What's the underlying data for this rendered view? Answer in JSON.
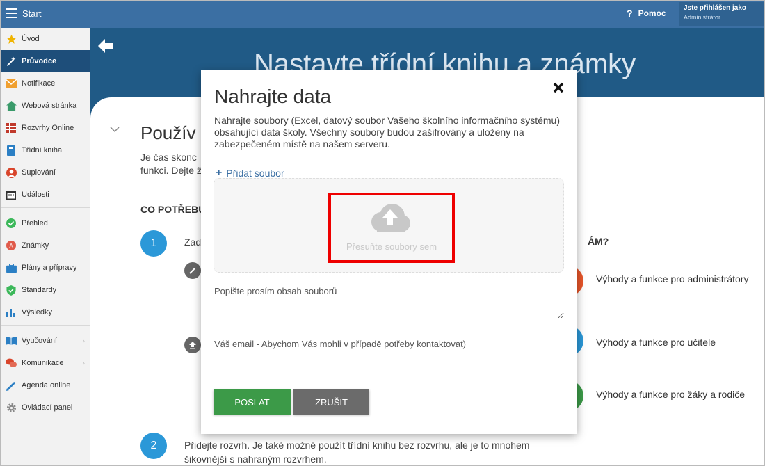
{
  "topbar": {
    "app_title": "Start",
    "help_label": "Pomoc",
    "user_line1": "Jste přihlášen jako",
    "user_line2": "Administrátor"
  },
  "sidebar": {
    "items": [
      {
        "label": "Úvod",
        "icon": "star-icon"
      },
      {
        "label": "Průvodce",
        "icon": "magic-wand-icon"
      },
      {
        "label": "Notifikace",
        "icon": "envelope-icon"
      },
      {
        "label": "Webová stránka",
        "icon": "home-icon"
      },
      {
        "label": "Rozvrhy Online",
        "icon": "calendar-grid-icon"
      },
      {
        "label": "Třídní kniha",
        "icon": "book-icon"
      },
      {
        "label": "Suplování",
        "icon": "person-icon"
      },
      {
        "label": "Události",
        "icon": "calendar-icon"
      },
      {
        "label": "Přehled",
        "icon": "check-circle-icon"
      },
      {
        "label": "Známky",
        "icon": "grade-icon"
      },
      {
        "label": "Plány a přípravy",
        "icon": "briefcase-icon"
      },
      {
        "label": "Standardy",
        "icon": "shield-check-icon"
      },
      {
        "label": "Výsledky",
        "icon": "bar-chart-icon"
      },
      {
        "label": "Vyučování",
        "icon": "open-book-icon"
      },
      {
        "label": "Komunikace",
        "icon": "chat-icon"
      },
      {
        "label": "Agenda online",
        "icon": "pen-icon"
      },
      {
        "label": "Ovládací panel",
        "icon": "gear-icon"
      }
    ]
  },
  "main": {
    "hero_title": "Nastavte třídní knihu a známky",
    "section_title": "Použív",
    "para": "Je čas skonc funkci. Dejte žáků.",
    "need_heading": "CO POTŘEBU",
    "step1_num": "1",
    "step1_text": "Zad",
    "step2_num": "2",
    "step2_text": "Přidejte rozvrh. Je také možné použít třídní knihu bez rozvrhu, ale je to mnohem šikovnější s nahraným rozvrhem.",
    "right_question": "ÁM?",
    "features": [
      {
        "text": "Výhody a funkce pro administrátory",
        "color": "#e8562a"
      },
      {
        "text": "Výhody a funkce pro učitele",
        "color": "#2b98d8"
      },
      {
        "text": "Výhody a funkce pro žáky a rodiče",
        "color": "#3c9a48"
      }
    ]
  },
  "modal": {
    "title": "Nahrajte data",
    "description": "Nahrajte soubory (Excel, datový soubor Vašeho školního informačního systému) obsahující data školy. Všechny soubory budou zašifrovány a uloženy na zabezpečeném místě na našem serveru.",
    "add_file": "Přidat soubor",
    "drop_text": "Přesuňte soubory sem",
    "describe_label": "Popište prosím obsah souborů",
    "email_label": "Váš email - Abychom Vás mohli v případě potřeby kontaktovat)",
    "email_value": "",
    "send_label": "POSLAT",
    "cancel_label": "ZRUŠIT"
  },
  "colors": {
    "topbar": "#3b6fa3",
    "hero": "#205a86",
    "active_sidebar": "#1e4e7a",
    "send_button": "#3c9a48",
    "cancel_button": "#6b6b6b",
    "highlight_box": "#ee0000"
  }
}
